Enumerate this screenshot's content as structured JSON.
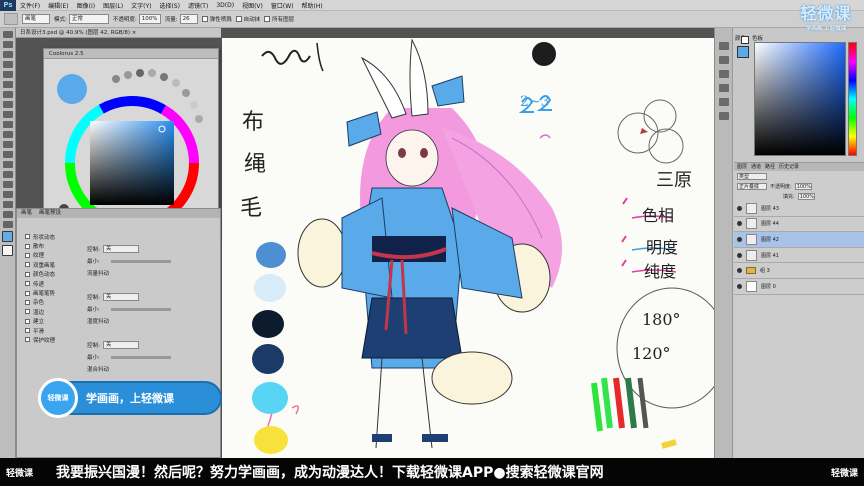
{
  "menubar": {
    "logo": "Ps",
    "items": [
      "文件(F)",
      "编辑(E)",
      "图像(I)",
      "图层(L)",
      "文字(Y)",
      "选择(S)",
      "滤镜(T)",
      "3D(D)",
      "视图(V)",
      "窗口(W)",
      "帮助(H)"
    ]
  },
  "options": {
    "preset": "画笔",
    "mode_label": "模式:",
    "mode_value": "正常",
    "opacity_label": "不透明度:",
    "opacity_value": "100%",
    "flow_label": "流量:",
    "flow_value": "26",
    "check1": "弹性喷溅",
    "check2": "自动抹",
    "check3": "所有图层"
  },
  "document": {
    "tab": "日系设计3.psd @ 40.9% (图层 42, RGB/8) ×"
  },
  "coolorus": {
    "title": "Coolorus 2.5",
    "current_color": "#5aa9e8"
  },
  "brush": {
    "tabs": [
      "画笔",
      "画笔预设"
    ],
    "rows": [
      "形状动态",
      "散布",
      "纹理",
      "双重画笔",
      "颜色动态",
      "传递",
      "画笔笔势",
      "杂色",
      "湿边",
      "建立",
      "平滑",
      "保护纹理"
    ],
    "ctl1_label": "控制:",
    "ctl1_value": "关",
    "min_label": "最小:",
    "jitter1": "流量抖动",
    "ctl2_label": "控制:",
    "ctl2_value": "关",
    "jitter2": "湿度抖动",
    "ctl3_label": "控制:",
    "ctl3_value": "关",
    "jitter3": "混合抖动"
  },
  "promo": {
    "logo": "轻微课",
    "text": "学画画，上轻微课"
  },
  "watermark": {
    "big": "轻微课",
    "small": "学画画 上轻微课"
  },
  "color_panel": {
    "tabs": [
      "颜色",
      "色板"
    ]
  },
  "layers": {
    "tabs": [
      "图层",
      "通道",
      "路径",
      "历史记录"
    ],
    "kind_label": "类型",
    "blend": "正片叠底",
    "opacity_label": "不透明度:",
    "opacity": "100%",
    "fill_label": "填充:",
    "fill": "100%",
    "items": [
      {
        "name": "图层 43",
        "active": false
      },
      {
        "name": "图层 44",
        "active": false
      },
      {
        "name": "图层 42",
        "active": true
      },
      {
        "name": "图层 41",
        "active": false
      },
      {
        "name": "组 3",
        "active": false
      },
      {
        "name": "图层 0",
        "active": false
      }
    ]
  },
  "canvas": {
    "notes": [
      "布",
      "绳",
      "毛",
      "三原",
      "色相",
      "明度",
      "纯度",
      "180°",
      "120°",
      "2~3"
    ],
    "palette": [
      "#4d8fd0",
      "#d8ecf8",
      "#0d1b2e",
      "#1b3a66",
      "#58d4f4",
      "#f6e23a"
    ]
  },
  "banner": {
    "logo": "轻微课",
    "text": "我要振兴国漫！然后呢？努力学画画，成为动漫达人！下载轻微课APP●搜索轻微课官网",
    "logo_right": "轻微课"
  }
}
